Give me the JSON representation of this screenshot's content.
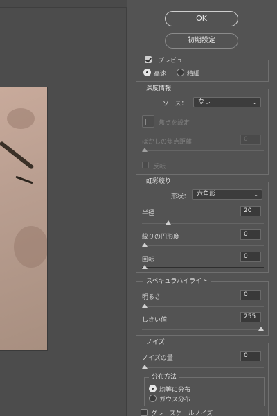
{
  "dialog": {
    "ok_label": "OK",
    "reset_label": "初期設定"
  },
  "preview": {
    "label": "プレビュー",
    "checked": true,
    "modes": [
      "高速",
      "精細"
    ],
    "selected_mode": "高速"
  },
  "depth_map": {
    "title": "深度情報",
    "source_label": "ソース：",
    "source_value": "なし",
    "set_focus_label": "焦点を設定",
    "blur_focal_distance_label": "ぼかしの焦点距離",
    "blur_focal_distance_value": "0",
    "invert_label": "反転"
  },
  "iris": {
    "title": "虹彩絞り",
    "shape_label": "形状：",
    "shape_value": "六角形",
    "radius_label": "半径",
    "radius_value": "20",
    "roundness_label": "絞りの円形度",
    "roundness_value": "0",
    "rotation_label": "回転",
    "rotation_value": "0"
  },
  "specular": {
    "title": "スペキュラハイライト",
    "brightness_label": "明るさ",
    "brightness_value": "0",
    "threshold_label": "しきい値",
    "threshold_value": "255"
  },
  "noise": {
    "title": "ノイズ",
    "amount_label": "ノイズの量",
    "amount_value": "0",
    "distribution_title": "分布方法",
    "distribution_options": [
      "均等に分布",
      "ガウス分布"
    ],
    "distribution_selected": "均等に分布",
    "monochromatic_label": "グレースケールノイズ"
  },
  "slider_levels": {
    "blur_focal_distance": 0,
    "radius": 0.2,
    "roundness": 0,
    "rotation": 0,
    "brightness": 0,
    "threshold": 1.0,
    "noise_amount": 0
  }
}
